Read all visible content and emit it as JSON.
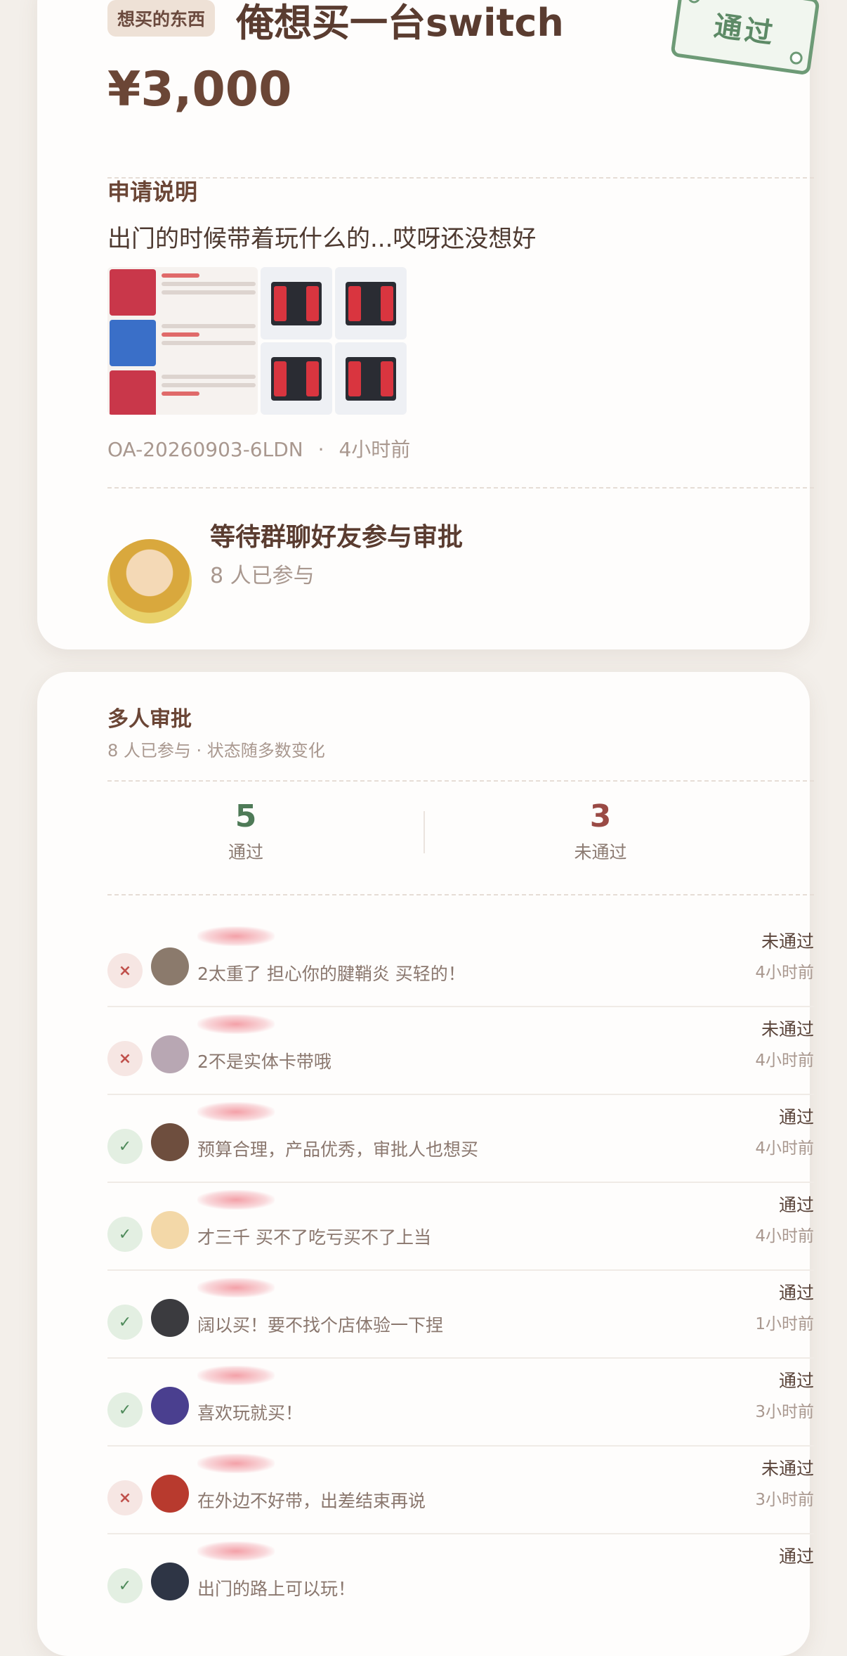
{
  "request": {
    "tag": "想买的东西",
    "title": "俺想买一台switch",
    "amount": "¥3,000",
    "stamp": "通过",
    "section_label": "申请说明",
    "description": "出门的时候带着玩什么的...哎呀还没想好",
    "id": "OA-20260903-6LDN",
    "separator": "·",
    "time": "4小时前",
    "waiting": "等待群聊好友参与审批",
    "joined": "8 人已参与"
  },
  "approval": {
    "title": "多人审批",
    "subtitle": "8 人已参与 · 状态随多数变化",
    "pass_count": "5",
    "pass_label": "通过",
    "fail_count": "3",
    "fail_label": "未通过",
    "items": [
      {
        "status": "未通过",
        "result": "fail",
        "comment": "2太重了 担心你的腱鞘炎 买轻的！",
        "time": "4小时前",
        "avatar_color": "#8b7a6c"
      },
      {
        "status": "未通过",
        "result": "fail",
        "comment": "2不是实体卡带哦",
        "time": "4小时前",
        "avatar_color": "#b8a7b3"
      },
      {
        "status": "通过",
        "result": "pass",
        "comment": "预算合理，产品优秀，审批人也想买",
        "time": "4小时前",
        "avatar_color": "#6e4e3e"
      },
      {
        "status": "通过",
        "result": "pass",
        "comment": "才三千 买不了吃亏买不了上当",
        "time": "4小时前",
        "avatar_color": "#f3d8a8"
      },
      {
        "status": "通过",
        "result": "pass",
        "comment": "阔以买！要不找个店体验一下捏",
        "time": "1小时前",
        "avatar_color": "#3b3b3f"
      },
      {
        "status": "通过",
        "result": "pass",
        "comment": "喜欢玩就买！",
        "time": "3小时前",
        "avatar_color": "#4a3f8f"
      },
      {
        "status": "未通过",
        "result": "fail",
        "comment": "在外边不好带，出差结束再说",
        "time": "3小时前",
        "avatar_color": "#b83a2e"
      },
      {
        "status": "通过",
        "result": "pass",
        "comment": "出门的路上可以玩！",
        "time": "",
        "avatar_color": "#2e3545"
      }
    ]
  },
  "icons": {
    "pass": "✓",
    "fail": "×"
  }
}
